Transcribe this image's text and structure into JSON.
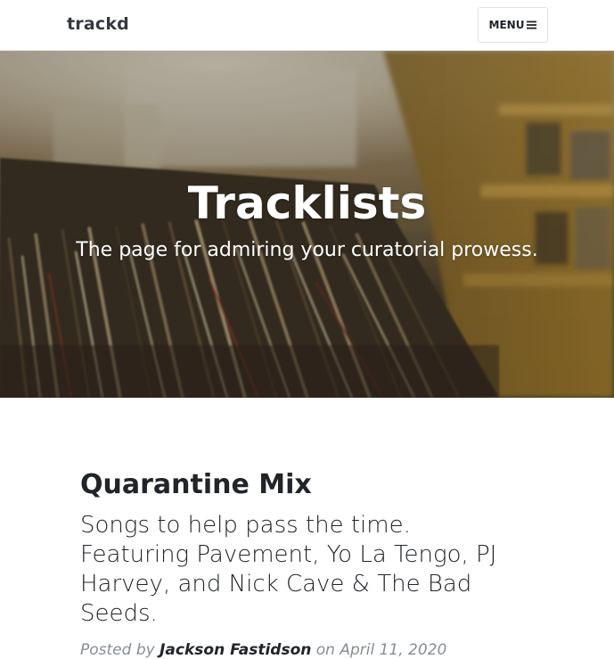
{
  "navbar": {
    "brand": "trackd",
    "menu_label": "MENU",
    "menu_icon": "bars-icon"
  },
  "hero": {
    "title": "Tracklists",
    "subtitle": "The page for admiring your curatorial prowess."
  },
  "post": {
    "title": "Quarantine Mix",
    "subtitle": "Songs to help pass the time. Featuring Pavement, Yo La Tengo, PJ Harvey, and Nick Cave & The Bad Seeds.",
    "meta_prefix": "Posted by",
    "author": "Jackson Fastidson",
    "date": "on April 11, 2020"
  },
  "colors": {
    "text": "#212529",
    "muted": "#868e96",
    "nav_bg": "#ffffff",
    "hero_text": "#ffffff"
  }
}
